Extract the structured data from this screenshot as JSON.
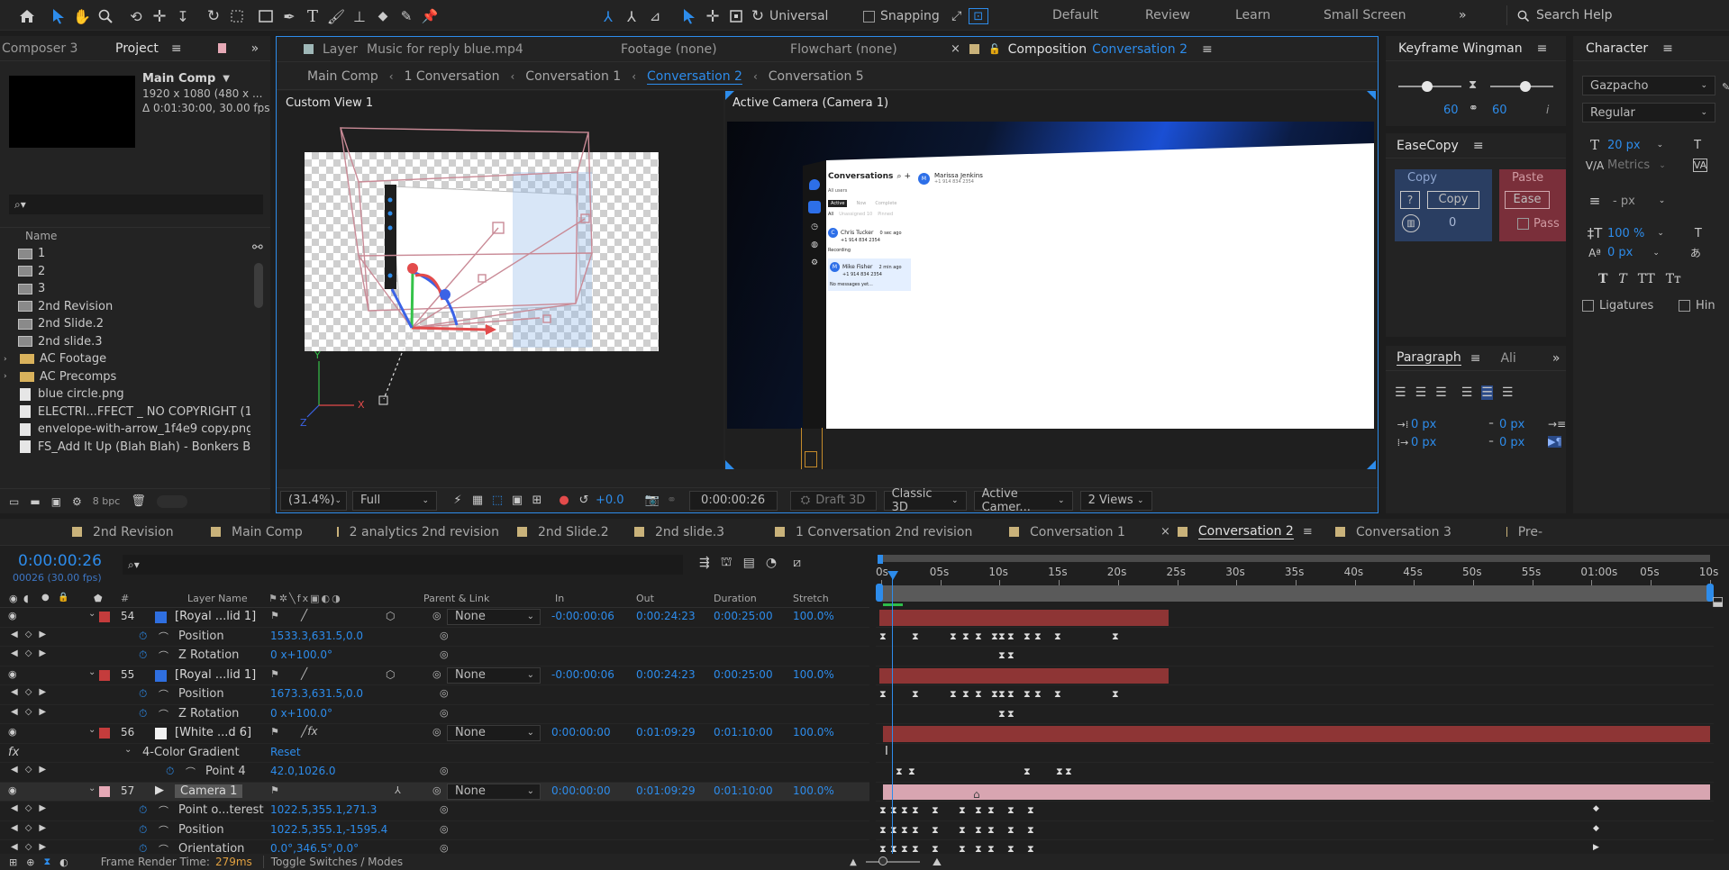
{
  "toolbar": {
    "universal": "Universal",
    "snapping": "Snapping",
    "workspaces": [
      "Default",
      "Review",
      "Learn",
      "Small Screen"
    ],
    "search_placeholder": "Search Help"
  },
  "project": {
    "tab_composer": "Composer 3",
    "tab_project": "Project",
    "comp_name": "Main Comp",
    "comp_size": "1920 x 1080  (480 x ...",
    "comp_duration": "Δ 0:01:30:00, 30.00 fps",
    "col_name": "Name",
    "bpc": "8 bpc",
    "items": [
      {
        "label": "1",
        "type": "comp"
      },
      {
        "label": "2",
        "type": "comp"
      },
      {
        "label": "3",
        "type": "comp"
      },
      {
        "label": "2nd Revision",
        "type": "comp"
      },
      {
        "label": "2nd Slide.2",
        "type": "comp"
      },
      {
        "label": "2nd slide.3",
        "type": "comp"
      },
      {
        "label": "AC Footage",
        "type": "folder"
      },
      {
        "label": "AC Precomps",
        "type": "folder"
      },
      {
        "label": "blue circle.png",
        "type": "file"
      },
      {
        "label": "ELECTRI...FFECT _ NO COPYRIGHT (1",
        "type": "file"
      },
      {
        "label": "envelope-with-arrow_1f4e9 copy.png",
        "type": "file"
      },
      {
        "label": "FS_Add It Up (Blah Blah) - Bonkers Bl",
        "type": "file"
      }
    ]
  },
  "viewer": {
    "tab_layer": "Layer",
    "layer_name": "Music for reply blue.mp4",
    "footage": "Footage  (none)",
    "flowchart": "Flowchart  (none)",
    "composition_label": "Composition",
    "composition_name": "Conversation 2",
    "breadcrumbs": [
      "Main Comp",
      "1 Conversation",
      "Conversation 1",
      "Conversation 2",
      "Conversation 5"
    ],
    "active_crumb": 3,
    "view_left": "Custom View 1",
    "view_right": "Active Camera (Camera 1)",
    "zoom": "(31.4%)",
    "resolution": "Full",
    "exposure": "+0.0",
    "timecode": "0:00:00:26",
    "draft": "Draft 3D",
    "renderer": "Classic 3D",
    "camera": "Active Camer...",
    "views": "2 Views"
  },
  "mock_app": {
    "title": "Conversations",
    "contact": "Marissa Jenkins",
    "contact_phone": "+1 914 834 2354",
    "filter": "All users",
    "tabs": [
      "Active",
      "Now",
      "Complete"
    ],
    "subtabs": [
      "All",
      "Unassigned 10",
      "Pinned"
    ],
    "items": [
      {
        "initial": "C",
        "name": "Chris Tucker",
        "time": "0 sec ago",
        "phone": "+1 914 834 2354",
        "msg": "Recording"
      },
      {
        "initial": "M",
        "name": "Mike Fisher",
        "time": "2 min ago",
        "phone": "+1 914 834 2354",
        "msg": "No messages yet..."
      }
    ]
  },
  "keyframe_wingman": {
    "title": "Keyframe Wingman",
    "left": "60",
    "right": "60"
  },
  "easecopy": {
    "title": "EaseCopy",
    "copy_label": "Copy",
    "copy_btn": "Copy",
    "count": "0",
    "paste_label": "Paste",
    "ease_btn": "Ease",
    "pass": "Pass"
  },
  "character": {
    "title": "Character",
    "font": "Gazpacho",
    "style": "Regular",
    "size": "20 px",
    "metrics": "Metrics",
    "leading": "- px",
    "vscale": "100 %",
    "baseline": "0 px",
    "ligatures": "Ligatures",
    "hindi": "Hin",
    "type_buttons": [
      "T",
      "T",
      "TT",
      "Tт"
    ]
  },
  "paragraph": {
    "title": "Paragraph",
    "align_tab": "Ali",
    "indent_left": "0 px",
    "indent_first": "0 px",
    "space_before": "0 px",
    "space_after": "0 px"
  },
  "timeline": {
    "tabs": [
      {
        "label": "2nd Revision",
        "color": "#c9b27a"
      },
      {
        "label": "Main Comp",
        "color": "#c9b27a"
      },
      {
        "label": "2 analytics 2nd revision",
        "color": "#c9b27a"
      },
      {
        "label": "2nd Slide.2",
        "color": "#c9b27a"
      },
      {
        "label": "2nd slide.3",
        "color": "#c9b27a"
      },
      {
        "label": "1 Conversation 2nd revision",
        "color": "#c9b27a"
      },
      {
        "label": "Conversation 1",
        "color": "#c9b27a"
      },
      {
        "label": "Conversation 2",
        "color": "#c9b27a"
      },
      {
        "label": "Conversation 3",
        "color": "#c9b27a"
      },
      {
        "label": "Pre-",
        "color": "#c9b27a"
      }
    ],
    "active_tab": 7,
    "timecode": "0:00:00:26",
    "frames": "00026 (30.00 fps)",
    "columns": {
      "layer_name": "Layer Name",
      "parent": "Parent & Link",
      "in": "In",
      "out": "Out",
      "duration": "Duration",
      "stretch": "Stretch",
      "num": "#"
    },
    "ruler": [
      "0s",
      "05s",
      "10s",
      "15s",
      "20s",
      "25s",
      "30s",
      "35s",
      "40s",
      "45s",
      "50s",
      "55s",
      "01:00s",
      "05s",
      "10s"
    ],
    "frame_render_label": "Frame Render Time:",
    "frame_render_value": "279ms",
    "toggle": "Toggle Switches / Modes",
    "layers": [
      {
        "num": "54",
        "label_color": "#c43c3c",
        "icon_color": "#2f6fe0",
        "name": "[Royal ...lid 1]",
        "parent": "None",
        "in": "-0:00:00:06",
        "out": "0:00:24:23",
        "dur": "0:00:25:00",
        "stretch": "100.0%"
      },
      {
        "num": "55",
        "label_color": "#c43c3c",
        "icon_color": "#2f6fe0",
        "name": "[Royal ...lid 1]",
        "parent": "None",
        "in": "-0:00:00:06",
        "out": "0:00:24:23",
        "dur": "0:00:25:00",
        "stretch": "100.0%"
      },
      {
        "num": "56",
        "label_color": "#c43c3c",
        "icon_color": "#f2f2f2",
        "name": "[White ...d 6]",
        "parent": "None",
        "in": "0:00:00:00",
        "out": "0:01:09:29",
        "dur": "0:01:10:00",
        "stretch": "100.0%"
      },
      {
        "num": "57",
        "label_color": "#e6a9b6",
        "icon_color": "camera",
        "name": "Camera 1",
        "parent": "None",
        "in": "0:00:00:00",
        "out": "0:01:09:29",
        "dur": "0:01:10:00",
        "stretch": "100.0%"
      }
    ],
    "props": {
      "p54_pos": {
        "name": "Position",
        "value": "1533.3,631.5,0.0"
      },
      "p54_rot": {
        "name": "Z Rotation",
        "value": "0 x+100.0°"
      },
      "p55_pos": {
        "name": "Position",
        "value": "1673.3,631.5,0.0"
      },
      "p55_rot": {
        "name": "Z Rotation",
        "value": "0 x+100.0°"
      },
      "effect": {
        "name": "4-Color Gradient",
        "reset": "Reset"
      },
      "point4": {
        "name": "Point 4",
        "value": "42.0,1026.0"
      },
      "poi": {
        "name": "Point o...terest",
        "value": "1022.5,355.1,271.3"
      },
      "cam_pos": {
        "name": "Position",
        "value": "1022.5,355.1,-1595.4"
      },
      "orient": {
        "name": "Orientation",
        "value": "0.0°,346.5°,0.0°"
      }
    }
  },
  "colors": {
    "accent": "#2d8ceb",
    "red_bar": "#8e3535",
    "pink_bar": "#d8a5b1",
    "panel": "#232323"
  }
}
